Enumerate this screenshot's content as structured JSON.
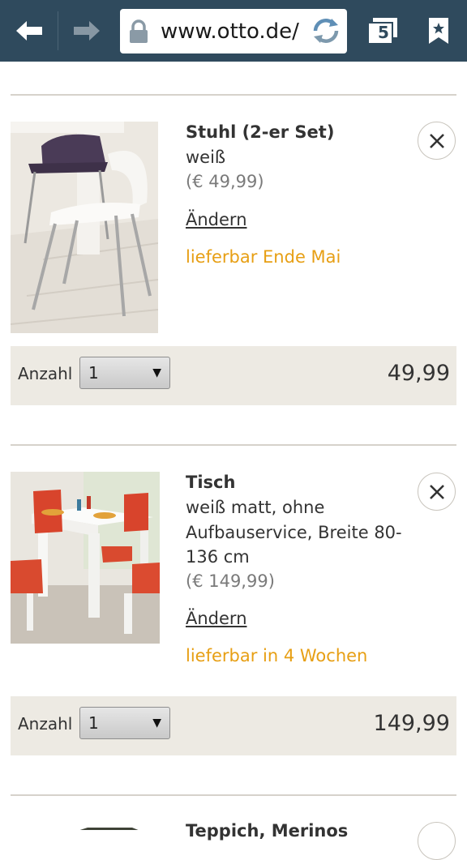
{
  "browser": {
    "url": "www.otto.de/",
    "tab_count": "5"
  },
  "cart": {
    "quantity_label": "Anzahl",
    "items": [
      {
        "title": "Stuhl (2-er Set)",
        "description": "weiß",
        "unit_price": "(€ 49,99)",
        "change_label": "Ändern",
        "delivery": "lieferbar Ende Mai",
        "quantity": "1",
        "total": "49,99"
      },
      {
        "title": "Tisch",
        "description": "weiß matt, ohne Aufbauservice, Breite 80-136 cm",
        "unit_price": "(€ 149,99)",
        "change_label": "Ändern",
        "delivery": "lieferbar in 4 Wochen",
        "quantity": "1",
        "total": "149,99"
      },
      {
        "title": "Teppich, Merinos"
      }
    ]
  },
  "colors": {
    "toolbar": "#2f4a5d",
    "delivery_text": "#e79f14",
    "quantity_bar": "#edeae3",
    "divider": "#d6d2cb"
  }
}
